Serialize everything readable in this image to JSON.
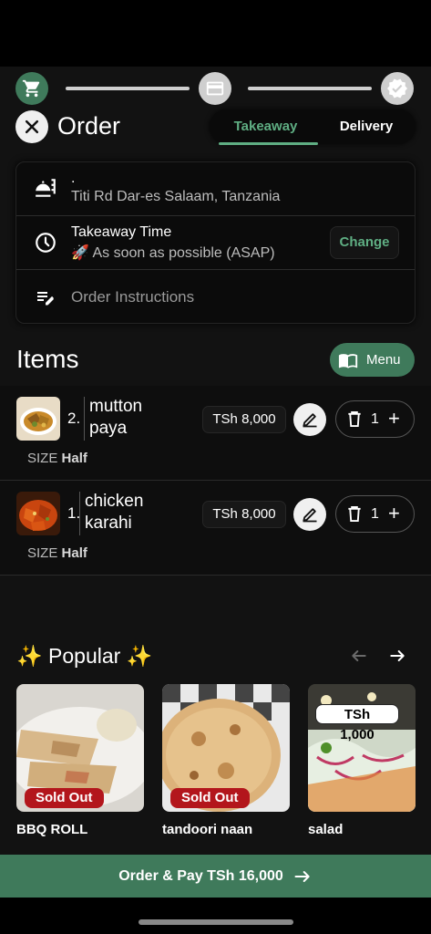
{
  "stepper": {
    "steps": [
      {
        "icon": "cart-icon",
        "active": true
      },
      {
        "icon": "card-icon",
        "active": false
      },
      {
        "icon": "check-badge-icon",
        "active": false
      }
    ]
  },
  "header": {
    "title": "Order",
    "tabs": [
      {
        "label": "Takeaway",
        "active": true
      },
      {
        "label": "Delivery",
        "active": false
      }
    ]
  },
  "info": {
    "location_name": ".",
    "address": "Titi Rd Dar-es Salaam, Tanzania",
    "time_label": "Takeaway Time",
    "time_value": "🚀 As soon as possible (ASAP)",
    "change_label": "Change",
    "instructions_placeholder": "Order Instructions"
  },
  "items_section": {
    "title": "Items",
    "menu_label": "Menu",
    "items": [
      {
        "index": "2.",
        "name_line1": "mutton",
        "name_line2": "paya",
        "price": "TSh 8,000",
        "quantity": "1",
        "size_label": "SIZE",
        "size_value": "Half"
      },
      {
        "index": "1.",
        "name_line1": "chicken",
        "name_line2": "karahi",
        "price": "TSh 8,000",
        "quantity": "1",
        "size_label": "SIZE",
        "size_value": "Half"
      }
    ]
  },
  "popular": {
    "title": "✨ Popular ✨",
    "products": [
      {
        "name": "BBQ ROLL",
        "badge": "Sold Out",
        "badge_type": "sold"
      },
      {
        "name": "tandoori naan",
        "badge": "Sold Out",
        "badge_type": "sold"
      },
      {
        "name": "salad",
        "badge": "TSh 1,000",
        "badge_type": "price"
      }
    ]
  },
  "checkout": {
    "label": "Order & Pay TSh 16,000"
  },
  "colors": {
    "accent": "#3f7a5b",
    "accent_text": "#5fae83",
    "background": "#121212",
    "sold_out": "#b3161c"
  }
}
